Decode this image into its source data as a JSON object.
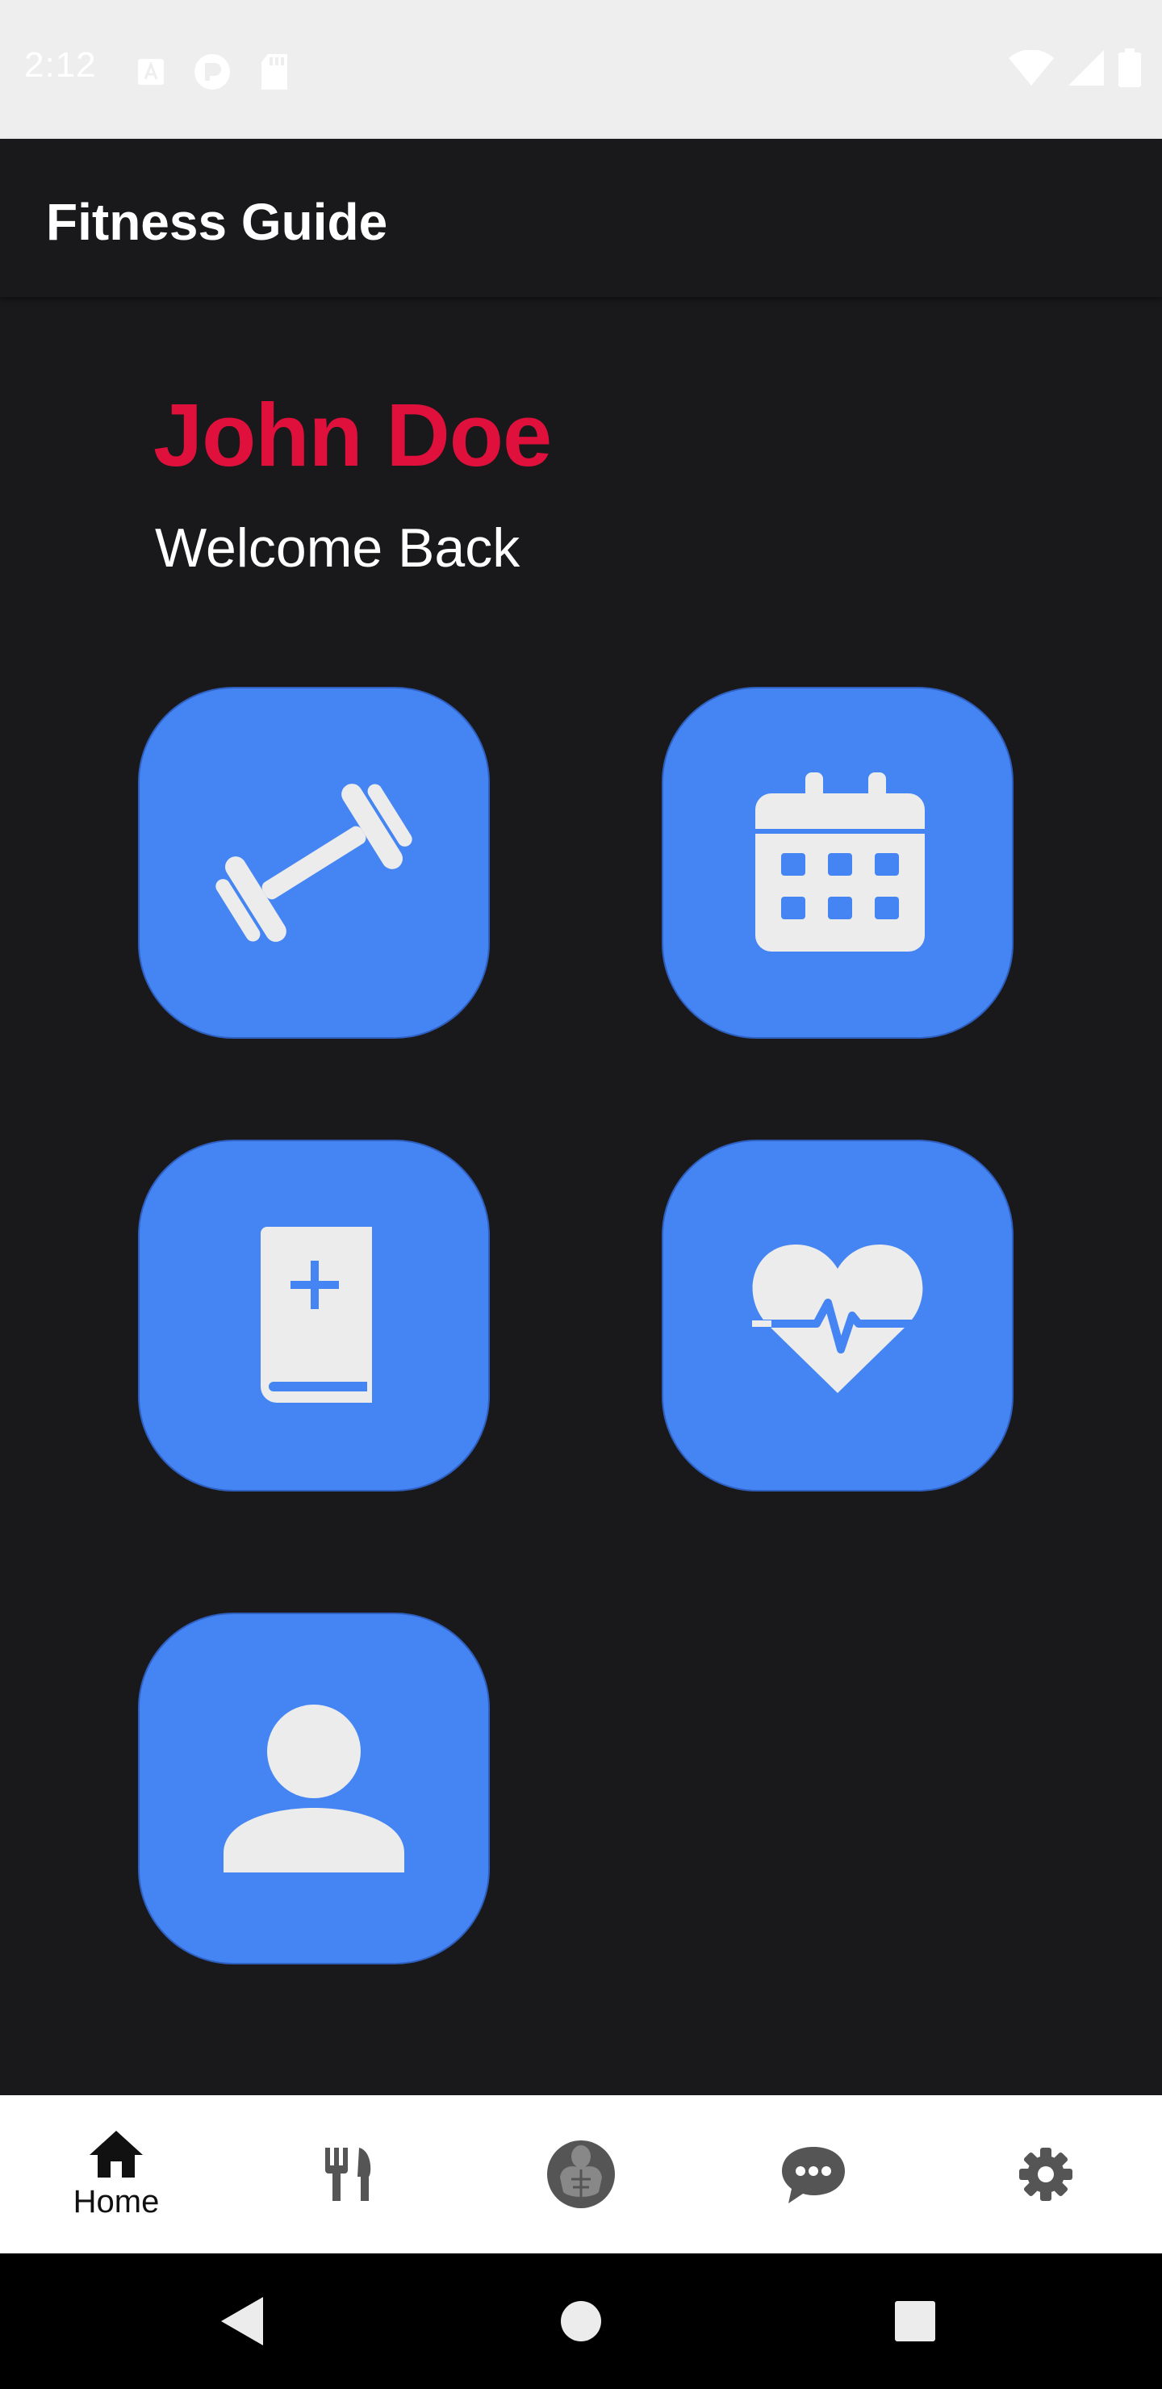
{
  "status_bar": {
    "time": "2:12",
    "left_icons": [
      "font-notification-icon",
      "app-notification-icon",
      "sd-card-icon"
    ],
    "right_icons": [
      "wifi-icon",
      "signal-icon",
      "battery-icon"
    ]
  },
  "app_bar": {
    "title": "Fitness Guide"
  },
  "profile": {
    "name": "John Doe",
    "greeting": "Welcome Back"
  },
  "tiles": [
    {
      "icon": "dumbbell-icon"
    },
    {
      "icon": "calendar-icon"
    },
    {
      "icon": "book-plus-icon"
    },
    {
      "icon": "heart-pulse-icon"
    },
    {
      "icon": "person-icon"
    }
  ],
  "bottom_nav": {
    "items": [
      {
        "icon": "home-icon",
        "label": "Home",
        "selected": true
      },
      {
        "icon": "fork-knife-icon",
        "label": ""
      },
      {
        "icon": "muscle-body-icon",
        "label": ""
      },
      {
        "icon": "chat-bubble-icon",
        "label": ""
      },
      {
        "icon": "gear-icon",
        "label": ""
      }
    ]
  },
  "system_nav": {
    "buttons": [
      "back-icon",
      "home-circle-icon",
      "recents-icon"
    ]
  },
  "colors": {
    "accent_name": "#e0103c",
    "tile_blue": "#4585f3",
    "background": "#19191b",
    "icon_fill": "#ececec"
  }
}
